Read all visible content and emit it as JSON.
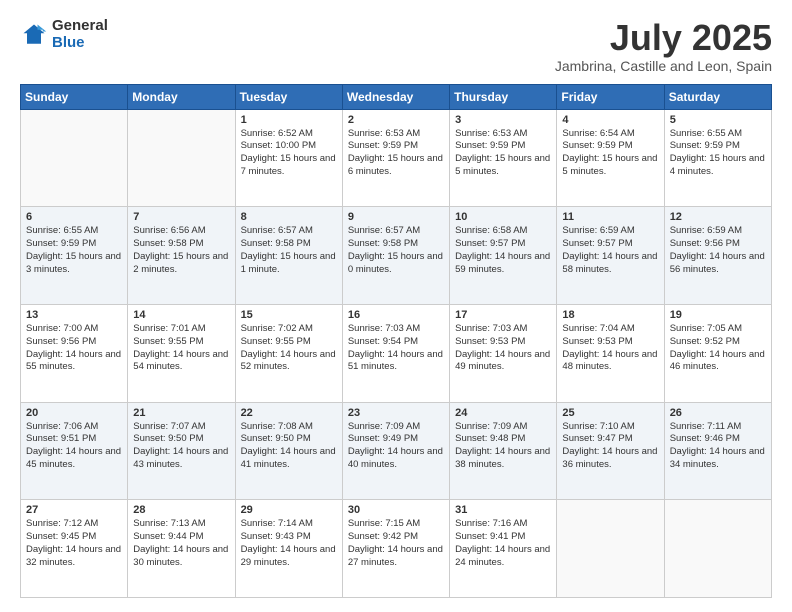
{
  "logo": {
    "general": "General",
    "blue": "Blue"
  },
  "title": {
    "month": "July 2025",
    "location": "Jambrina, Castille and Leon, Spain"
  },
  "headers": [
    "Sunday",
    "Monday",
    "Tuesday",
    "Wednesday",
    "Thursday",
    "Friday",
    "Saturday"
  ],
  "weeks": [
    [
      {
        "day": "",
        "text": ""
      },
      {
        "day": "",
        "text": ""
      },
      {
        "day": "1",
        "text": "Sunrise: 6:52 AM\nSunset: 10:00 PM\nDaylight: 15 hours\nand 7 minutes."
      },
      {
        "day": "2",
        "text": "Sunrise: 6:53 AM\nSunset: 9:59 PM\nDaylight: 15 hours\nand 6 minutes."
      },
      {
        "day": "3",
        "text": "Sunrise: 6:53 AM\nSunset: 9:59 PM\nDaylight: 15 hours\nand 5 minutes."
      },
      {
        "day": "4",
        "text": "Sunrise: 6:54 AM\nSunset: 9:59 PM\nDaylight: 15 hours\nand 5 minutes."
      },
      {
        "day": "5",
        "text": "Sunrise: 6:55 AM\nSunset: 9:59 PM\nDaylight: 15 hours\nand 4 minutes."
      }
    ],
    [
      {
        "day": "6",
        "text": "Sunrise: 6:55 AM\nSunset: 9:59 PM\nDaylight: 15 hours\nand 3 minutes."
      },
      {
        "day": "7",
        "text": "Sunrise: 6:56 AM\nSunset: 9:58 PM\nDaylight: 15 hours\nand 2 minutes."
      },
      {
        "day": "8",
        "text": "Sunrise: 6:57 AM\nSunset: 9:58 PM\nDaylight: 15 hours\nand 1 minute."
      },
      {
        "day": "9",
        "text": "Sunrise: 6:57 AM\nSunset: 9:58 PM\nDaylight: 15 hours\nand 0 minutes."
      },
      {
        "day": "10",
        "text": "Sunrise: 6:58 AM\nSunset: 9:57 PM\nDaylight: 14 hours\nand 59 minutes."
      },
      {
        "day": "11",
        "text": "Sunrise: 6:59 AM\nSunset: 9:57 PM\nDaylight: 14 hours\nand 58 minutes."
      },
      {
        "day": "12",
        "text": "Sunrise: 6:59 AM\nSunset: 9:56 PM\nDaylight: 14 hours\nand 56 minutes."
      }
    ],
    [
      {
        "day": "13",
        "text": "Sunrise: 7:00 AM\nSunset: 9:56 PM\nDaylight: 14 hours\nand 55 minutes."
      },
      {
        "day": "14",
        "text": "Sunrise: 7:01 AM\nSunset: 9:55 PM\nDaylight: 14 hours\nand 54 minutes."
      },
      {
        "day": "15",
        "text": "Sunrise: 7:02 AM\nSunset: 9:55 PM\nDaylight: 14 hours\nand 52 minutes."
      },
      {
        "day": "16",
        "text": "Sunrise: 7:03 AM\nSunset: 9:54 PM\nDaylight: 14 hours\nand 51 minutes."
      },
      {
        "day": "17",
        "text": "Sunrise: 7:03 AM\nSunset: 9:53 PM\nDaylight: 14 hours\nand 49 minutes."
      },
      {
        "day": "18",
        "text": "Sunrise: 7:04 AM\nSunset: 9:53 PM\nDaylight: 14 hours\nand 48 minutes."
      },
      {
        "day": "19",
        "text": "Sunrise: 7:05 AM\nSunset: 9:52 PM\nDaylight: 14 hours\nand 46 minutes."
      }
    ],
    [
      {
        "day": "20",
        "text": "Sunrise: 7:06 AM\nSunset: 9:51 PM\nDaylight: 14 hours\nand 45 minutes."
      },
      {
        "day": "21",
        "text": "Sunrise: 7:07 AM\nSunset: 9:50 PM\nDaylight: 14 hours\nand 43 minutes."
      },
      {
        "day": "22",
        "text": "Sunrise: 7:08 AM\nSunset: 9:50 PM\nDaylight: 14 hours\nand 41 minutes."
      },
      {
        "day": "23",
        "text": "Sunrise: 7:09 AM\nSunset: 9:49 PM\nDaylight: 14 hours\nand 40 minutes."
      },
      {
        "day": "24",
        "text": "Sunrise: 7:09 AM\nSunset: 9:48 PM\nDaylight: 14 hours\nand 38 minutes."
      },
      {
        "day": "25",
        "text": "Sunrise: 7:10 AM\nSunset: 9:47 PM\nDaylight: 14 hours\nand 36 minutes."
      },
      {
        "day": "26",
        "text": "Sunrise: 7:11 AM\nSunset: 9:46 PM\nDaylight: 14 hours\nand 34 minutes."
      }
    ],
    [
      {
        "day": "27",
        "text": "Sunrise: 7:12 AM\nSunset: 9:45 PM\nDaylight: 14 hours\nand 32 minutes."
      },
      {
        "day": "28",
        "text": "Sunrise: 7:13 AM\nSunset: 9:44 PM\nDaylight: 14 hours\nand 30 minutes."
      },
      {
        "day": "29",
        "text": "Sunrise: 7:14 AM\nSunset: 9:43 PM\nDaylight: 14 hours\nand 29 minutes."
      },
      {
        "day": "30",
        "text": "Sunrise: 7:15 AM\nSunset: 9:42 PM\nDaylight: 14 hours\nand 27 minutes."
      },
      {
        "day": "31",
        "text": "Sunrise: 7:16 AM\nSunset: 9:41 PM\nDaylight: 14 hours\nand 24 minutes."
      },
      {
        "day": "",
        "text": ""
      },
      {
        "day": "",
        "text": ""
      }
    ]
  ]
}
